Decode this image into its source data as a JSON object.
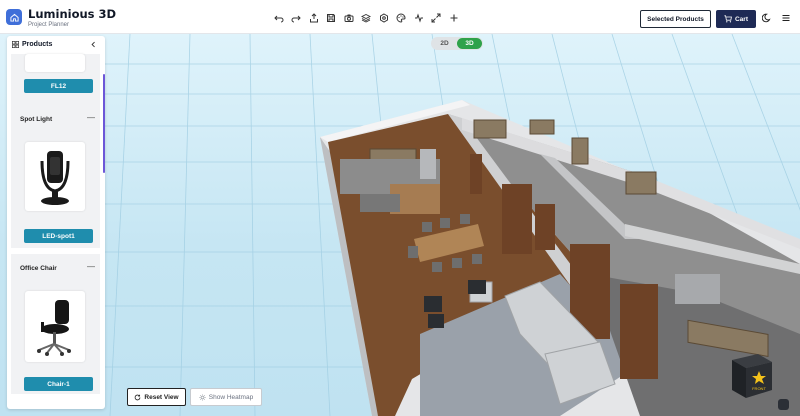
{
  "app": {
    "title": "Luminious 3D",
    "subtitle": "Project Planner",
    "logo_icon": "home-icon"
  },
  "toolbar": {
    "tools": [
      "undo-icon",
      "redo-icon",
      "export-icon",
      "save-icon",
      "camera-icon",
      "layers-icon",
      "settings-icon",
      "palette-icon",
      "activity-icon",
      "expand-icon",
      "add-icon"
    ],
    "selected_products_label": "Selected Products",
    "cart_label": "Cart",
    "theme_icon": "moon-icon",
    "menu_icon": "menu-icon"
  },
  "view_toggle": {
    "options": [
      "2D",
      "3D"
    ],
    "active": "3D"
  },
  "sidebar": {
    "title": "Products",
    "sections": [
      {
        "name": "",
        "product_label": "FL12"
      },
      {
        "name": "Spot Light",
        "product_label": "LED-spot1"
      },
      {
        "name": "Office Chair",
        "product_label": "Chair-1"
      }
    ]
  },
  "controls": {
    "reset_view_label": "Reset View",
    "heatmap_label": "Show Heatmap"
  },
  "view_cube": {
    "face_label": "FRONT",
    "icon": "star-icon"
  },
  "colors": {
    "accent": "#1f8dad",
    "cart": "#1e2a55",
    "toggle_active": "#2fa24a",
    "logo": "#3f6fd9"
  }
}
